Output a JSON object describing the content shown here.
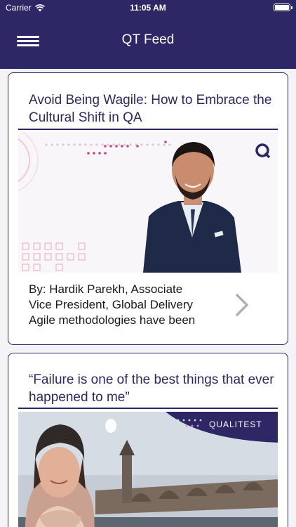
{
  "status_bar": {
    "carrier": "Carrier",
    "time": "11:05 AM",
    "icons": [
      "wifi-icon",
      "battery-icon"
    ]
  },
  "header": {
    "title": "QT Feed",
    "menu_icon": "hamburger-menu-icon"
  },
  "feed": {
    "cards": [
      {
        "title": "Avoid  Being Wagile: How to Embrace the Cultural Shift in QA",
        "image": "portrait of a man in a navy suit with Q logo",
        "text_lines": [
          "By: Hardik Parekh, Associate",
          "Vice President, Global Delivery",
          "Agile methodologies have been"
        ],
        "chevron_icon": "chevron-right-icon"
      },
      {
        "title": "“Failure is one of the best things that ever happened to me”",
        "image": "woman in knit hat in front of a stone bridge",
        "brand_label": "QUALITEST"
      }
    ]
  },
  "colors": {
    "brand": "#2d2766",
    "card_border": "#2d2766",
    "chevron": "#a8b2ba"
  }
}
